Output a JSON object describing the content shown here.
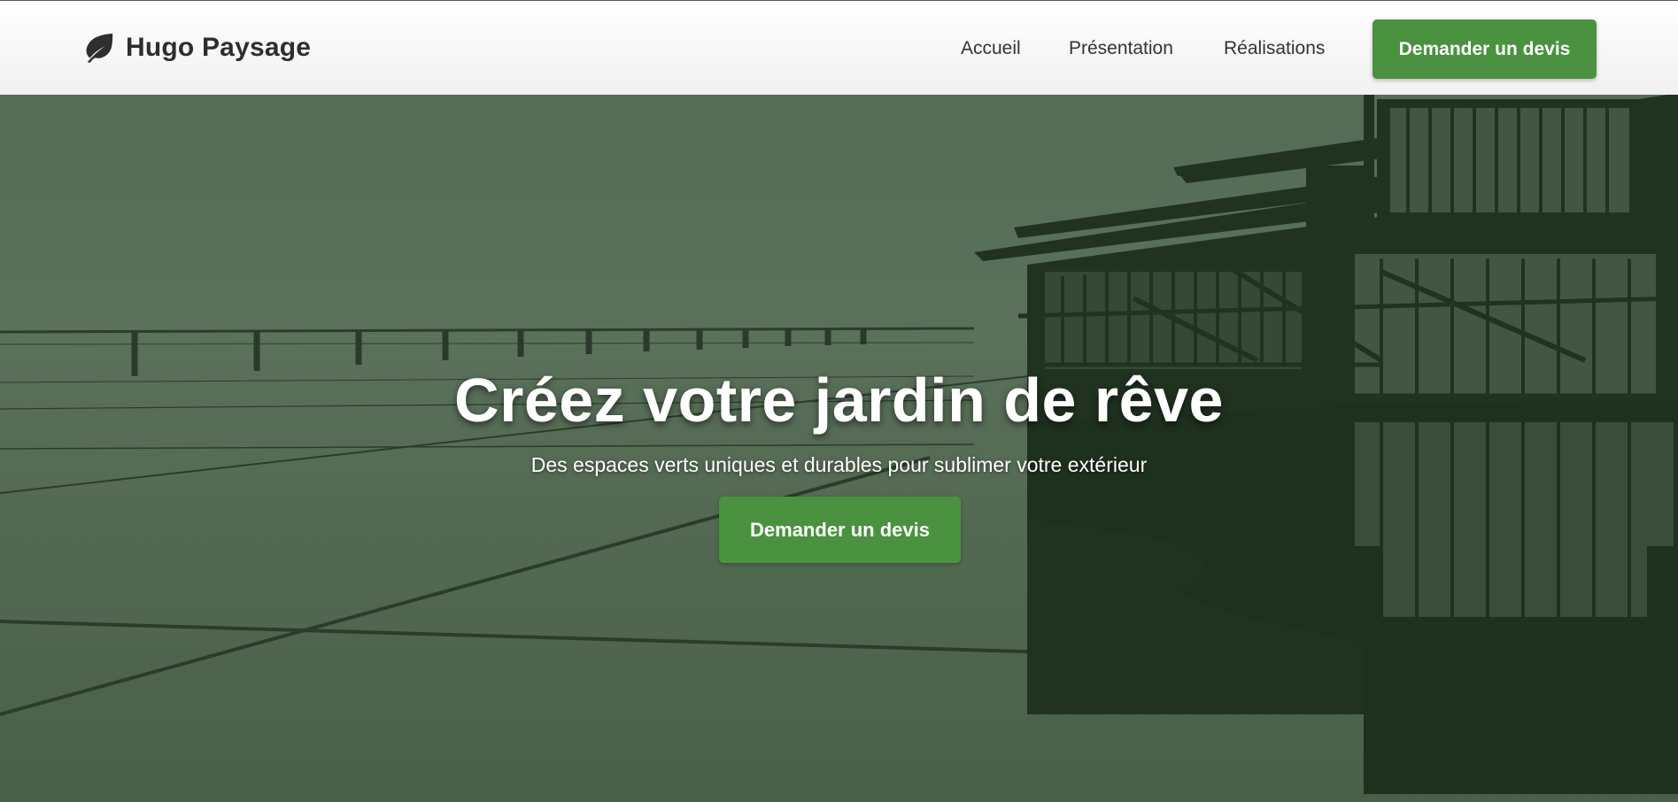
{
  "header": {
    "brand": {
      "name": "Hugo Paysage",
      "icon": "leaf-icon"
    },
    "nav": [
      {
        "label": "Accueil"
      },
      {
        "label": "Présentation"
      },
      {
        "label": "Réalisations"
      }
    ],
    "cta_label": "Demander un devis"
  },
  "hero": {
    "title": "Créez votre jardin de rêve",
    "subtitle": "Des espaces verts uniques et durables pour sublimer votre extérieur",
    "cta_label": "Demander un devis",
    "background": "architectural-building-reflection-photo"
  },
  "colors": {
    "accent": "#4a9140",
    "overlay": "#5f7560",
    "text_dark": "#333333"
  }
}
